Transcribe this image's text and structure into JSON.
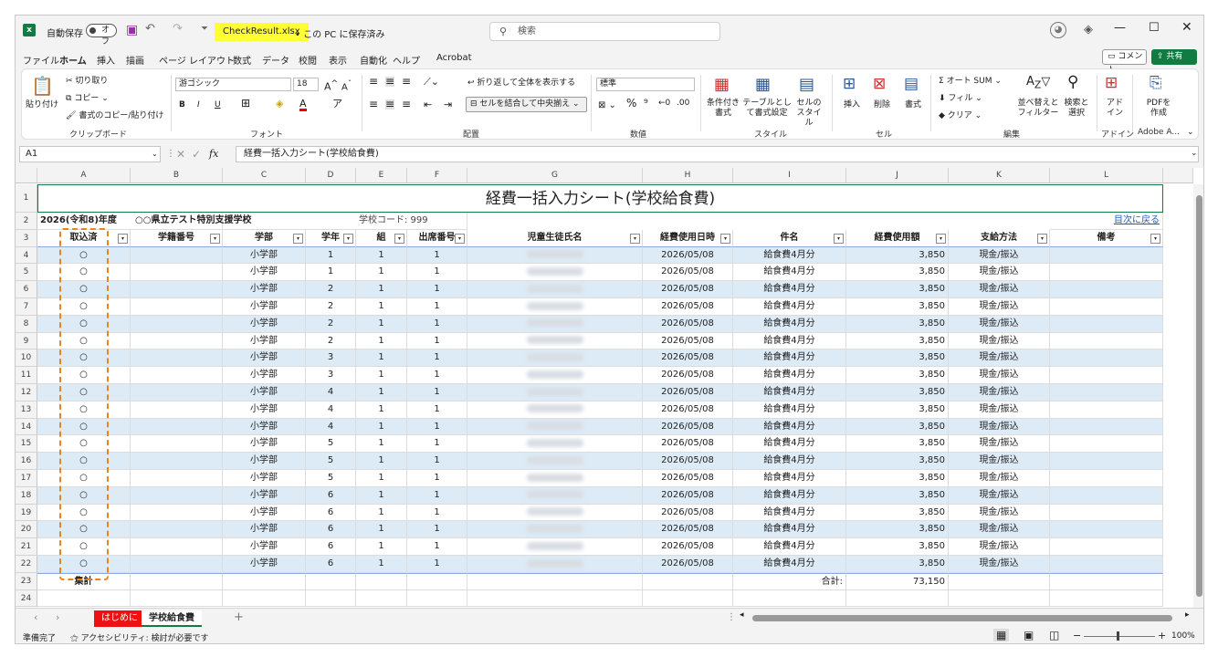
{
  "titlebar": {
    "autosave_label": "自動保存",
    "autosave_state": "オフ",
    "filename": "CheckResult.xlsx",
    "save_status": "• この PC に保存済み",
    "search_placeholder": "検索"
  },
  "menus": [
    "ファイル",
    "ホーム",
    "挿入",
    "描画",
    "ページ レイアウト",
    "数式",
    "データ",
    "校閲",
    "表示",
    "自動化",
    "ヘルプ",
    "Acrobat"
  ],
  "active_menu": "ホーム",
  "comment_button": "コメント",
  "share_button": "共有",
  "ribbon": {
    "clipboard": {
      "paste": "貼り付け",
      "cut": "切り取り",
      "copy": "コピー",
      "format_painter": "書式のコピー/貼り付け",
      "label": "クリップボード"
    },
    "font": {
      "name": "游ゴシック",
      "size": "18",
      "label": "フォント",
      "bold": "B",
      "italic": "I",
      "underline": "U"
    },
    "alignment": {
      "wrap": "折り返して全体を表示する",
      "merge": "セルを結合して中央揃え",
      "label": "配置"
    },
    "number": {
      "format": "標準",
      "percent": "%",
      "label": "数値"
    },
    "styles": {
      "conditional": "条件付き書式",
      "table": "テーブルとして書式設定",
      "cell": "セルのスタイル",
      "label": "スタイル"
    },
    "cells": {
      "insert": "挿入",
      "delete": "削除",
      "format": "書式",
      "label": "セル"
    },
    "editing": {
      "autosum": "オート SUM",
      "fill": "フィル",
      "clear": "クリア",
      "sort": "並べ替えとフィルター",
      "find": "検索と選択",
      "label": "編集"
    },
    "addins": {
      "addin": "アドイン",
      "label": "アドイン"
    },
    "adobe": {
      "pdf": "PDFを作成",
      "label": "Adobe A..."
    }
  },
  "formula_bar": {
    "name_box": "A1",
    "fx": "fx",
    "content": "経費一括入力シート(学校給食費)"
  },
  "columns": [
    "A",
    "B",
    "C",
    "D",
    "E",
    "F",
    "G",
    "H",
    "I",
    "J",
    "K",
    "L"
  ],
  "sheet": {
    "title": "経費一括入力シート(学校給食費)",
    "row2": {
      "year": "2026(令和8)年度",
      "school": "○○県立テスト特別支援学校",
      "code": "学校コード: 999",
      "link": "目次に戻る"
    },
    "headers": [
      "取込済",
      "学籍番号",
      "学部",
      "学年",
      "組",
      "出席番号",
      "児童生徒氏名",
      "経費使用日時",
      "件名",
      "経費使用額",
      "支給方法",
      "備考"
    ],
    "rows": [
      [
        "○",
        "",
        "小学部",
        "1",
        "1",
        "1",
        "",
        "2026/05/08",
        "給食費4月分",
        "3,850",
        "現金/振込",
        ""
      ],
      [
        "○",
        "",
        "小学部",
        "1",
        "1",
        "1",
        "",
        "2026/05/08",
        "給食費4月分",
        "3,850",
        "現金/振込",
        ""
      ],
      [
        "○",
        "",
        "小学部",
        "2",
        "1",
        "1",
        "",
        "2026/05/08",
        "給食費4月分",
        "3,850",
        "現金/振込",
        ""
      ],
      [
        "○",
        "",
        "小学部",
        "2",
        "1",
        "1",
        "",
        "2026/05/08",
        "給食費4月分",
        "3,850",
        "現金/振込",
        ""
      ],
      [
        "○",
        "",
        "小学部",
        "2",
        "1",
        "1",
        "",
        "2026/05/08",
        "給食費4月分",
        "3,850",
        "現金/振込",
        ""
      ],
      [
        "○",
        "",
        "小学部",
        "2",
        "1",
        "1",
        "",
        "2026/05/08",
        "給食費4月分",
        "3,850",
        "現金/振込",
        ""
      ],
      [
        "○",
        "",
        "小学部",
        "3",
        "1",
        "1",
        "",
        "2026/05/08",
        "給食費4月分",
        "3,850",
        "現金/振込",
        ""
      ],
      [
        "○",
        "",
        "小学部",
        "3",
        "1",
        "1",
        "",
        "2026/05/08",
        "給食費4月分",
        "3,850",
        "現金/振込",
        ""
      ],
      [
        "○",
        "",
        "小学部",
        "4",
        "1",
        "1",
        "",
        "2026/05/08",
        "給食費4月分",
        "3,850",
        "現金/振込",
        ""
      ],
      [
        "○",
        "",
        "小学部",
        "4",
        "1",
        "1",
        "",
        "2026/05/08",
        "給食費4月分",
        "3,850",
        "現金/振込",
        ""
      ],
      [
        "○",
        "",
        "小学部",
        "4",
        "1",
        "1",
        "",
        "2026/05/08",
        "給食費4月分",
        "3,850",
        "現金/振込",
        ""
      ],
      [
        "○",
        "",
        "小学部",
        "5",
        "1",
        "1",
        "",
        "2026/05/08",
        "給食費4月分",
        "3,850",
        "現金/振込",
        ""
      ],
      [
        "○",
        "",
        "小学部",
        "5",
        "1",
        "1",
        "",
        "2026/05/08",
        "給食費4月分",
        "3,850",
        "現金/振込",
        ""
      ],
      [
        "○",
        "",
        "小学部",
        "5",
        "1",
        "1",
        "",
        "2026/05/08",
        "給食費4月分",
        "3,850",
        "現金/振込",
        ""
      ],
      [
        "○",
        "",
        "小学部",
        "6",
        "1",
        "1",
        "",
        "2026/05/08",
        "給食費4月分",
        "3,850",
        "現金/振込",
        ""
      ],
      [
        "○",
        "",
        "小学部",
        "6",
        "1",
        "1",
        "",
        "2026/05/08",
        "給食費4月分",
        "3,850",
        "現金/振込",
        ""
      ],
      [
        "○",
        "",
        "小学部",
        "6",
        "1",
        "1",
        "",
        "2026/05/08",
        "給食費4月分",
        "3,850",
        "現金/振込",
        ""
      ],
      [
        "○",
        "",
        "小学部",
        "6",
        "1",
        "1",
        "",
        "2026/05/08",
        "給食費4月分",
        "3,850",
        "現金/振込",
        ""
      ],
      [
        "○",
        "",
        "小学部",
        "6",
        "1",
        "1",
        "",
        "2026/05/08",
        "給食費4月分",
        "3,850",
        "現金/振込",
        ""
      ]
    ],
    "total_row": {
      "label": "集計",
      "sum_label": "合計:",
      "sum": "73,150"
    }
  },
  "sheet_tabs": [
    "はじめに",
    "学校給食費"
  ],
  "active_sheet": "学校給食費",
  "status": {
    "ready": "準備完了",
    "accessibility": "アクセシビリティ: 検討が必要です",
    "zoom": "100%"
  },
  "colors": {
    "accent": "#107c41",
    "band": "#ddebf7",
    "highlight": "#ffff33",
    "callout": "#e8851f",
    "tab_red": "#ee1111"
  }
}
